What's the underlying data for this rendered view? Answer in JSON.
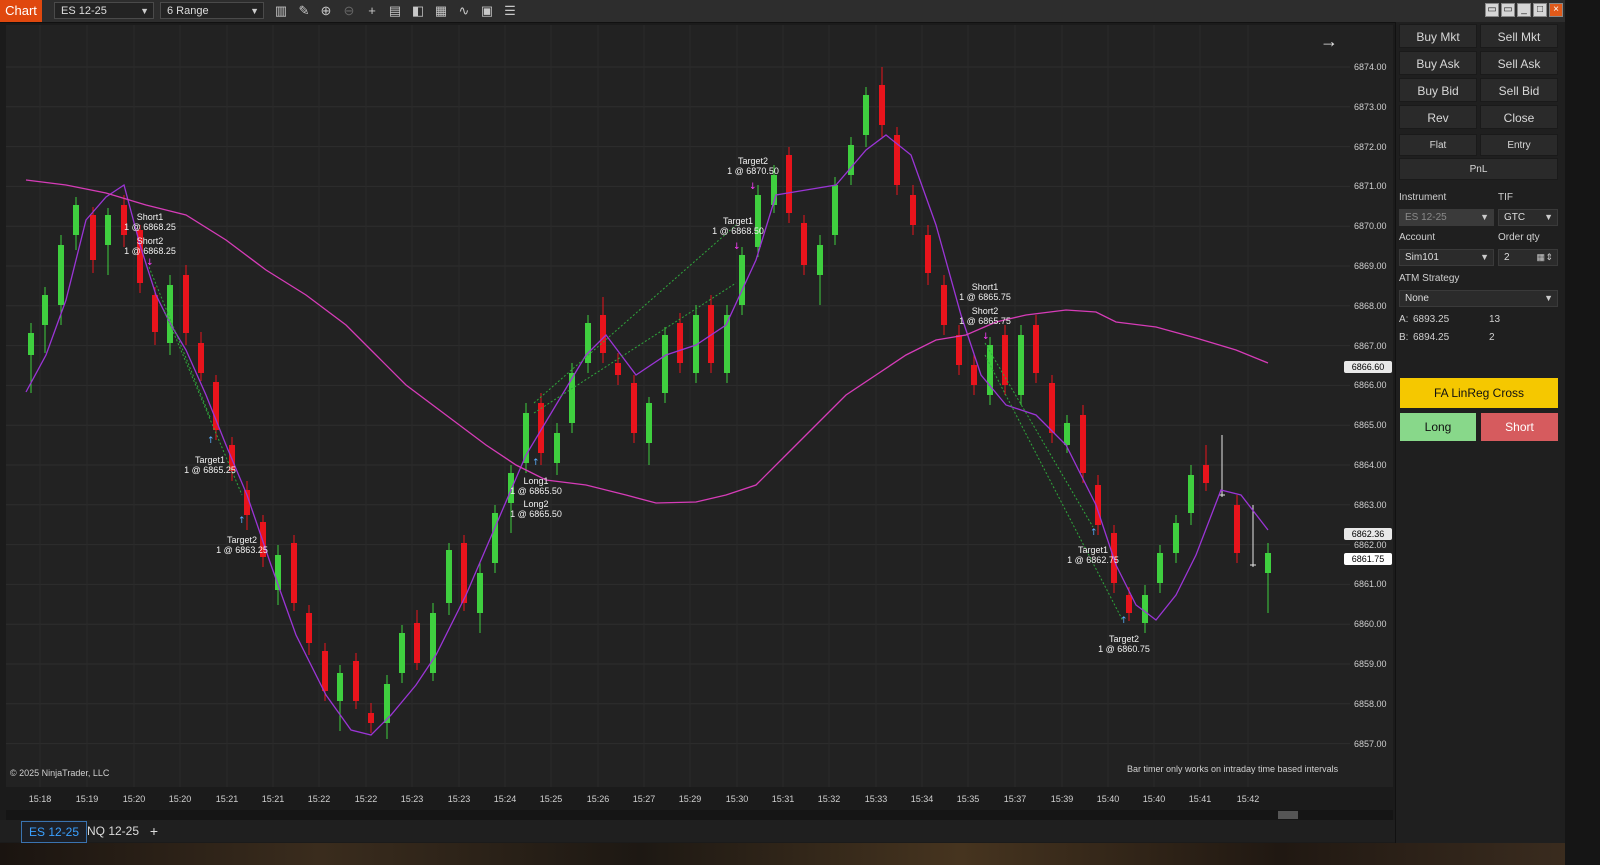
{
  "titlebar": {
    "app_title": "Chart",
    "instrument": "ES 12-25",
    "bar_type": "6 Range",
    "icons": [
      "bars-icon",
      "pencil-icon",
      "zoom-in-icon",
      "zoom-out-icon",
      "crosshair-icon",
      "properties-icon",
      "templates-icon",
      "data-box-icon",
      "indicators-icon",
      "strategies-icon",
      "list-icon"
    ],
    "window_buttons": [
      "restore-icon",
      "maximize-icon",
      "minimize-icon",
      "max-icon",
      "close-icon"
    ]
  },
  "chart": {
    "copyright": "© 2025 NinjaTrader, LLC",
    "bar_timer_msg": "Bar timer only works on intraday time based intervals",
    "price_labels": [
      "6874.00",
      "6873.00",
      "6872.00",
      "6871.00",
      "6870.00",
      "6869.00",
      "6868.00",
      "6867.00",
      "6866.00",
      "6865.00",
      "6864.00",
      "6863.00",
      "6862.00",
      "6861.00",
      "6860.00",
      "6859.00",
      "6858.00",
      "6857.00"
    ],
    "price_tags": [
      {
        "text": "6866.60",
        "color": "#e8e8e8"
      },
      {
        "text": "6862.36",
        "color": "#e8e8e8"
      },
      {
        "text": "6861.75",
        "color": "#ffffff"
      }
    ],
    "time_labels": [
      "15:18",
      "15:19",
      "15:20",
      "15:20",
      "15:21",
      "15:21",
      "15:22",
      "15:22",
      "15:23",
      "15:23",
      "15:24",
      "15:25",
      "15:26",
      "15:27",
      "15:29",
      "15:30",
      "15:31",
      "15:32",
      "15:33",
      "15:34",
      "15:35",
      "15:37",
      "15:39",
      "15:40",
      "15:40",
      "15:41",
      "15:42"
    ],
    "annotations": [
      {
        "label": "Short1",
        "detail": "1 @ 6868.25"
      },
      {
        "label": "Short2",
        "detail": "1 @ 6868.25"
      },
      {
        "label": "Target1",
        "detail": "1 @ 6865.25"
      },
      {
        "label": "Target2",
        "detail": "1 @ 6863.25"
      },
      {
        "label": "Long1",
        "detail": "1 @ 6865.50"
      },
      {
        "label": "Long2",
        "detail": "1 @ 6865.50"
      },
      {
        "label": "Target1",
        "detail": "1 @ 6868.50"
      },
      {
        "label": "Target2",
        "detail": "1 @ 6870.50"
      },
      {
        "label": "Short1",
        "detail": "1 @ 6865.75"
      },
      {
        "label": "Short2",
        "detail": "1 @ 6865.75"
      },
      {
        "label": "Target1",
        "detail": "1 @ 6862.75"
      },
      {
        "label": "Target2",
        "detail": "1 @ 6860.75"
      }
    ],
    "up_color": "#3fcf3f",
    "down_color": "#e8141c",
    "fast_ma_color": "#9b35d6",
    "slow_ma_color": "#d63cb8"
  },
  "tabs": [
    {
      "label": "ES 12-25",
      "active": true
    },
    {
      "label": "NQ 12-25",
      "active": false
    }
  ],
  "panel": {
    "order_buttons": [
      "Buy Mkt",
      "Sell Mkt",
      "Buy Ask",
      "Sell Ask",
      "Buy Bid",
      "Sell Bid",
      "Rev",
      "Close"
    ],
    "flat_label": "Flat",
    "entry_label": "Entry",
    "pnl_label": "PnL",
    "instrument_label": "Instrument",
    "instrument_value": "ES 12-25",
    "tif_label": "TIF",
    "tif_value": "GTC",
    "account_label": "Account",
    "account_value": "Sim101",
    "qty_label": "Order qty",
    "qty_value": "2",
    "atm_label": "ATM Strategy",
    "atm_value": "None",
    "ask_prefix": "A:",
    "ask_price": "6893.25",
    "ask_size": "13",
    "bid_prefix": "B:",
    "bid_price": "6894.25",
    "bid_size": "2",
    "strategy_button": "FA LinReg Cross",
    "long_button": "Long",
    "short_button": "Short"
  }
}
